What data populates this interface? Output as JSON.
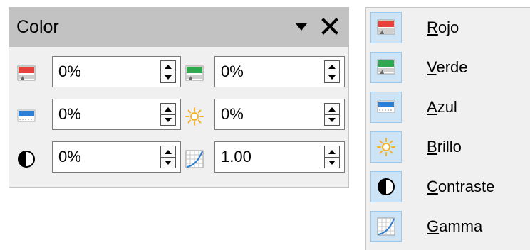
{
  "panel": {
    "title": "Color",
    "menu_icon": "triangle-down-icon",
    "close_icon": "close-icon",
    "fields": {
      "red": {
        "icon": "red-channel-icon",
        "value": "0%"
      },
      "green": {
        "icon": "green-channel-icon",
        "value": "0%"
      },
      "blue": {
        "icon": "blue-channel-icon",
        "value": "0%"
      },
      "brightness": {
        "icon": "brightness-icon",
        "value": "0%"
      },
      "contrast": {
        "icon": "contrast-icon",
        "value": "0%"
      },
      "gamma": {
        "icon": "gamma-icon",
        "value": "1.00"
      }
    }
  },
  "menu": {
    "items": [
      {
        "first": "R",
        "rest": "ojo",
        "icon": "red-channel-icon"
      },
      {
        "first": "V",
        "rest": "erde",
        "icon": "green-channel-icon"
      },
      {
        "first": "A",
        "rest": "zul",
        "icon": "blue-channel-icon"
      },
      {
        "first": "B",
        "rest": "rillo",
        "icon": "brightness-icon"
      },
      {
        "first": "C",
        "rest": "ontraste",
        "icon": "contrast-icon"
      },
      {
        "first": "G",
        "rest": "amma",
        "icon": "gamma-icon"
      }
    ]
  },
  "colors": {
    "header_bg": "#c2c2c2",
    "panel_bg": "#f0f0f0",
    "menu_icon_bg": "#cde4f7",
    "red": "#e8413c",
    "green": "#2fa84f",
    "blue": "#2b7fd4",
    "sun": "#f5b324"
  }
}
